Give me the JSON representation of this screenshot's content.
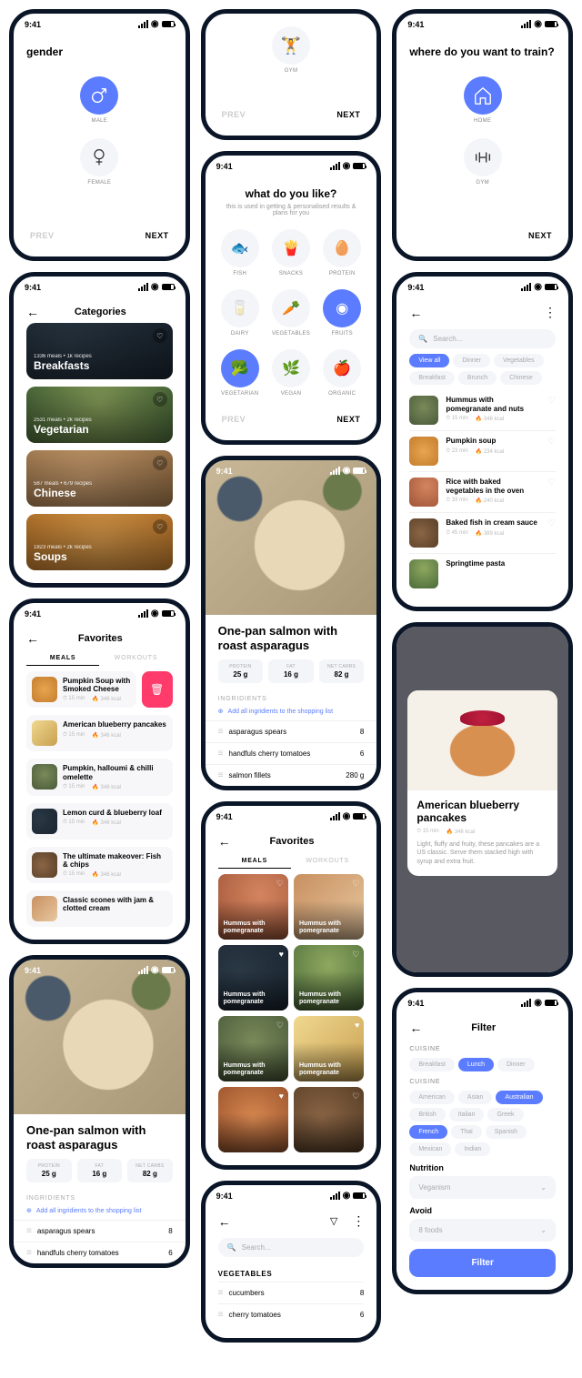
{
  "time": "9:41",
  "s1": {
    "title": "gender",
    "opt1": "male",
    "opt2": "female",
    "prev": "PREV",
    "next": "NEXT"
  },
  "s2": {
    "lbl": "gym",
    "prev": "PREV",
    "next": "NEXT"
  },
  "s3": {
    "title": "where do you want to train?",
    "opt1": "home",
    "opt2": "gym",
    "next": "NEXT"
  },
  "s4": {
    "title": "what do you like?",
    "sub": "this is used in getting & personalised results & plans for you",
    "opts": [
      "FISH",
      "SNACKS",
      "PROTEIN",
      "DAIRY",
      "VEGETABLES",
      "FRUITS",
      "VEGETARIAN",
      "VEGAN",
      "ORGANIC"
    ],
    "prev": "PREV",
    "next": "NEXT"
  },
  "s5": {
    "title": "Categories",
    "cats": [
      {
        "n": "Breakfasts",
        "m": "1336 meals • 1k recipes"
      },
      {
        "n": "Vegetarian",
        "m": "2531 meals • 2k recipes"
      },
      {
        "n": "Chinese",
        "m": "587 meals • 679 recipes"
      },
      {
        "n": "Soups",
        "m": "1823 meals • 2k recipes"
      }
    ]
  },
  "s6": {
    "ph": "Search...",
    "pills": [
      "View all",
      "Dinner",
      "Vegetables",
      "Breakfast",
      "Brunch",
      "Chinese"
    ],
    "items": [
      {
        "t": "Hummus with pomegranate and nuts",
        "m1": "15 min",
        "m2": "346 kcal"
      },
      {
        "t": "Pumpkin soup",
        "m1": "23 min",
        "m2": "234 kcal"
      },
      {
        "t": "Rice with baked vegetables in the oven",
        "m1": "33 min",
        "m2": "240 kcal"
      },
      {
        "t": "Baked fish in cream sauce",
        "m1": "45 min",
        "m2": "389 kcal"
      },
      {
        "t": "Springtime pasta",
        "m1": "",
        "m2": ""
      }
    ]
  },
  "s7": {
    "title": "Favorites",
    "tab1": "MEALS",
    "tab2": "WORKOUTS",
    "items": [
      {
        "t": "Pumpkin Soup with Smoked Cheese",
        "m1": "15 min",
        "m2": "346 kcal",
        "del": true
      },
      {
        "t": "American blueberry pancakes",
        "m1": "15 min",
        "m2": "346 kcal"
      },
      {
        "t": "Pumpkin, halloumi & chilli omelette",
        "m1": "15 min",
        "m2": "346 kcal"
      },
      {
        "t": "Lemon curd & blueberry loaf",
        "m1": "15 min",
        "m2": "346 kcal"
      },
      {
        "t": "The ultimate makeover: Fish & chips",
        "m1": "15 min",
        "m2": "346 kcal"
      },
      {
        "t": "Classic scones with jam & clotted cream",
        "m1": "",
        "m2": ""
      }
    ]
  },
  "s8": {
    "title": "One-pan salmon with roast asparagus",
    "m": [
      {
        "l": "PROTEIN",
        "v": "25 g"
      },
      {
        "l": "FAT",
        "v": "16 g"
      },
      {
        "l": "NET CARBS",
        "v": "82 g"
      }
    ],
    "sec": "INGRIDIENTS",
    "add": "Add all ingridients to the shopping list",
    "ing": [
      {
        "n": "asparagus spears",
        "q": "8"
      },
      {
        "n": "handfuls cherry tomatoes",
        "q": "6"
      },
      {
        "n": "salmon fillets",
        "q": "280 g"
      }
    ]
  },
  "s9": {
    "title": "Favorites",
    "tab1": "MEALS",
    "tab2": "WORKOUTS",
    "card": "Hummus with pomegranate"
  },
  "s10": {
    "title": "American blueberry pancakes",
    "m1": "15 min",
    "m2": "346 kcal",
    "desc": "Light, fluffy and fruity, these pancakes are a US classic. Serve them stacked high with syrup and extra fruit."
  },
  "s11": {
    "ph": "Search...",
    "sec": "VEGETABLES",
    "items": [
      {
        "n": "cucumbers",
        "q": "8"
      },
      {
        "n": "cherry tomatoes",
        "q": "6"
      }
    ]
  },
  "s12": {
    "title": "Filter",
    "l1": "CUISINE",
    "p1": [
      "Breakfast",
      "Lunch",
      "Dinner"
    ],
    "l2": "CUISINE",
    "p2": [
      "American",
      "Asian",
      "Australian",
      "British",
      "Italian",
      "Greek",
      "French",
      "Thai",
      "Spanish",
      "Mexican",
      "Indian"
    ],
    "l3": "Nutrition",
    "v3": "Veganism",
    "l4": "Avoid",
    "v4": "8 foods",
    "btn": "Filter"
  }
}
